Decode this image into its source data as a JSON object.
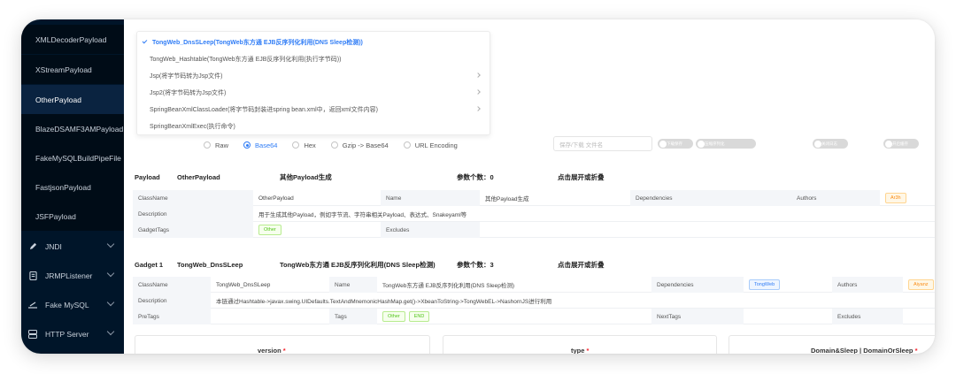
{
  "sidebar": {
    "items": [
      {
        "label": "XMLDecoderPayload"
      },
      {
        "label": "XStreamPayload"
      },
      {
        "label": "OtherPayload"
      },
      {
        "label": "BlazeDSAMF3AMPayload"
      },
      {
        "label": "FakeMySQLBuildPipeFile"
      },
      {
        "label": "FastjsonPayload"
      },
      {
        "label": "JSFPayload"
      }
    ],
    "groups": [
      {
        "label": "JNDI",
        "icon": "pencil-icon"
      },
      {
        "label": "JRMPListener",
        "icon": "document-icon"
      },
      {
        "label": "Fake MySQL",
        "icon": "edit-icon"
      },
      {
        "label": "HTTP Server",
        "icon": "server-icon"
      }
    ]
  },
  "dropdown": {
    "options": [
      {
        "label": "TongWeb_DnsSLeep(TongWeb东方通 EJB反序列化利用(DNS Sleep检测))",
        "selected": true
      },
      {
        "label": "TongWeb_Hashtable(TongWeb东方通 EJB反序列化利用(执行字节码))",
        "selected": false
      },
      {
        "label": "Jsp(将字节码转为Jsp文件)",
        "selected": false
      },
      {
        "label": "Jsp2(将字节码转为Jsp文件)",
        "selected": false
      },
      {
        "label": "SpringBeanXmlClassLoader(将字节码封装进spring bean.xml中，返回xml文件内容)",
        "selected": false
      },
      {
        "label": "SpringBeanXmlExec(执行命令)",
        "selected": false
      }
    ]
  },
  "encoding": {
    "options": [
      "Raw",
      "Base64",
      "Hex",
      "Gzip -> Base64",
      "URL Encoding"
    ],
    "selected": "Base64",
    "save_placeholder": "保存/下载 文件名",
    "toggles": [
      "下载保存",
      "压缩序列化",
      "关闭日志",
      "开启缓存"
    ]
  },
  "payload_section": {
    "header": {
      "title": "Payload",
      "name": "OtherPayload",
      "desc": "其他Payload生成",
      "param_count": "参数个数：0",
      "toggle": "点击展开或折叠"
    },
    "rows": {
      "classname_label": "ClassName",
      "classname_value": "OtherPayload",
      "name_label": "Name",
      "name_value": "其他Payload生成",
      "dependencies_label": "Dependencies",
      "authors_label": "Authors",
      "author_tag": "Ar3h",
      "description_label": "Description",
      "description_value": "用于生成其他Payload，例如字节流、字符串相关Payload、表达式、Snakeyaml等",
      "gadgettags_label": "GadgetTags",
      "gadgettags_tag": "Other",
      "excludes_label": "Excludes"
    }
  },
  "gadget_section": {
    "header": {
      "title": "Gadget 1",
      "name": "TongWeb_DnsSLeep",
      "desc": "TongWeb东方通 EJB反序列化利用(DNS Sleep检测)",
      "param_count": "参数个数：3",
      "toggle": "点击展开或折叠"
    },
    "rows": {
      "classname_label": "ClassName",
      "classname_value": "TongWeb_DnsSLeep",
      "name_label": "Name",
      "name_value": "TongWeb东方通 EJB反序列化利用(DNS Sleep检测)",
      "dependencies_label": "Dependencies",
      "dependency_tag": "TongWeb",
      "authors_label": "Authors",
      "author_tag": "Aiyanz",
      "description_label": "Description",
      "description_value": "本链通过Hashtable->javax.swing.UIDefaults.TextAndMnemonicHashMap.get()->XbeanToString->TongWebEL->NashornJS进行利用",
      "pretags_label": "PreTags",
      "tags_label": "Tags",
      "tags": [
        "Other",
        "END"
      ],
      "nexttags_label": "NextTags",
      "excludes_label": "Excludes"
    }
  },
  "params": [
    {
      "label": "version"
    },
    {
      "label": "type"
    },
    {
      "label": "Domain&Sleep | DomainOrSleep"
    }
  ]
}
